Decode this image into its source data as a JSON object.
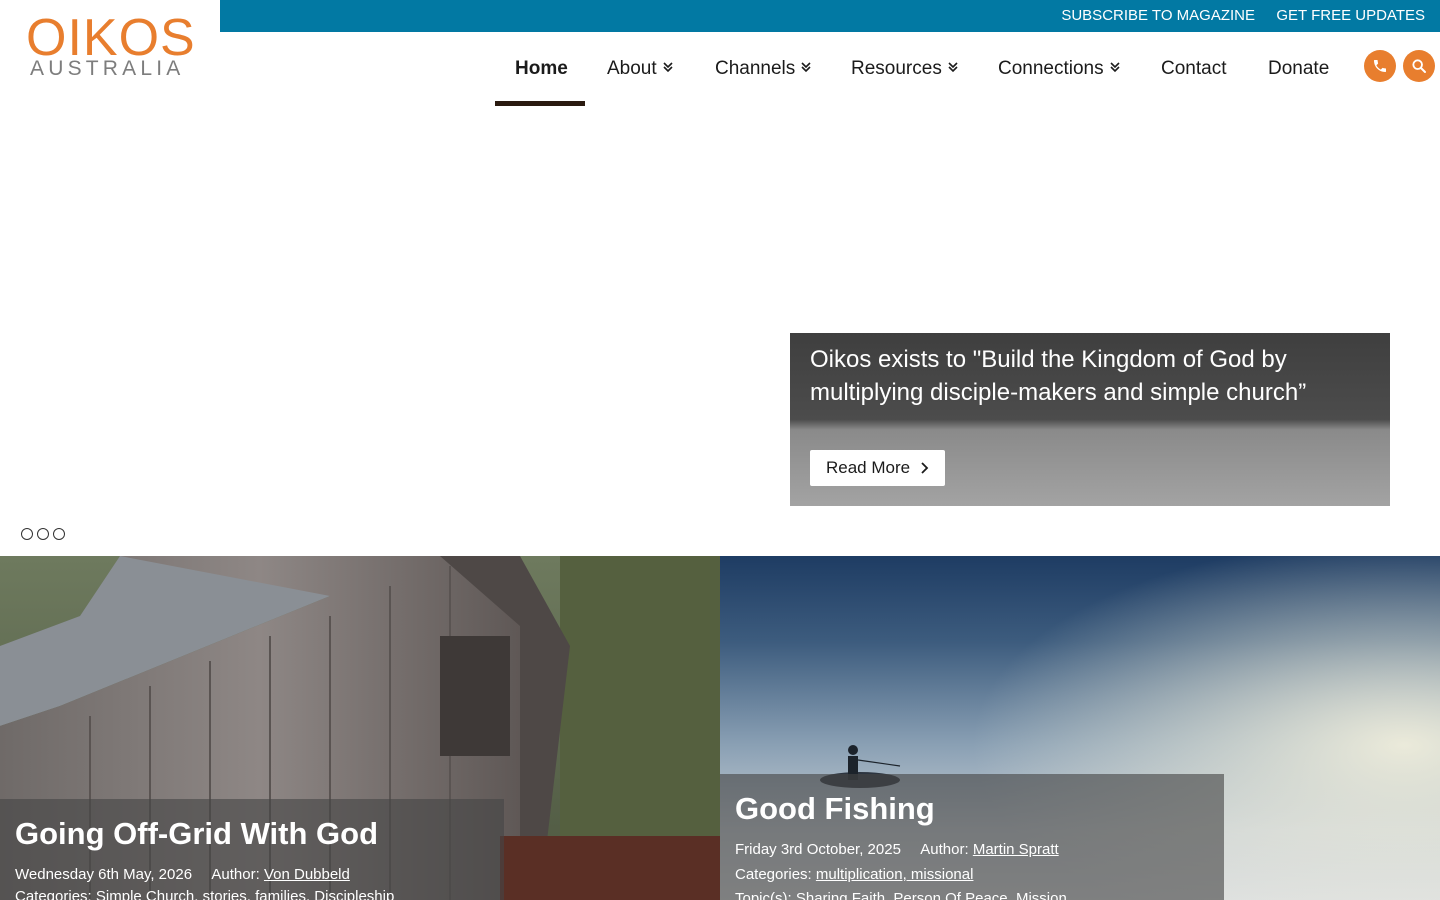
{
  "topbar": {
    "subscribe": "SUBSCRIBE TO MAGAZINE",
    "updates": "GET FREE UPDATES",
    "color": "#0279a3"
  },
  "logo": {
    "word": "OIKOS",
    "sub": "AUSTRALIA",
    "accent": "#e87e2e"
  },
  "nav": {
    "items": [
      {
        "label": "Home",
        "active": true
      },
      {
        "label": "About",
        "dropdown": true
      },
      {
        "label": "Channels",
        "dropdown": true
      },
      {
        "label": "Resources",
        "dropdown": true
      },
      {
        "label": "Connections",
        "dropdown": true
      },
      {
        "label": "Contact"
      },
      {
        "label": "Donate"
      }
    ],
    "phone_icon": "phone-icon",
    "search_icon": "search-icon"
  },
  "hero": {
    "caption": "Oikos exists to \"Build the Kingdom of God by multiplying disciple-makers and simple church”",
    "button": "Read More",
    "slides": 3
  },
  "cards": [
    {
      "title": "Going Off-Grid With God",
      "date": "Wednesday 6th May, 2026",
      "author_label": "Author:",
      "author": "Von Dubbeld",
      "categories_label": "Categories:",
      "categories": "Simple Church, stories, families, Discipleship"
    },
    {
      "title": "Good Fishing",
      "date": "Friday 3rd October, 2025",
      "author_label": "Author:",
      "author": "Martin Spratt",
      "categories_label": "Categories:",
      "categories": "multiplication, missional",
      "topics_label": "Topic(s):",
      "topics": "Sharing Faith, Person Of Peace, Mission"
    }
  ]
}
